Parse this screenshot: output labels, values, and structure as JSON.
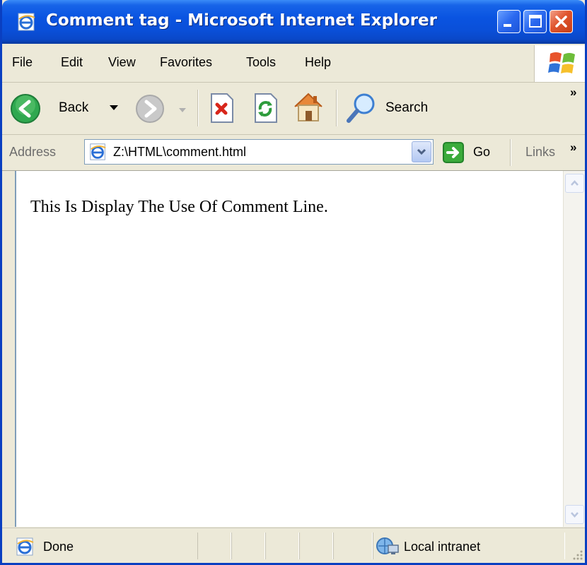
{
  "window": {
    "title": "Comment tag - Microsoft Internet Explorer"
  },
  "menu": {
    "items": [
      "File",
      "Edit",
      "View",
      "Favorites",
      "Tools",
      "Help"
    ]
  },
  "toolbar": {
    "back_label": "Back",
    "search_label": "Search",
    "more_chevron": "»"
  },
  "address": {
    "label": "Address",
    "value": "Z:\\HTML\\comment.html",
    "go_label": "Go",
    "links_label": "Links",
    "links_chevron": "»"
  },
  "page": {
    "text": "This Is Display The Use Of Comment Line."
  },
  "status": {
    "text": "Done",
    "zone": "Local intranet"
  },
  "colors": {
    "titlebar": "#0a54e1",
    "chrome": "#ece9d8",
    "close_button": "#e0552e",
    "back_green": "#2fa84f"
  },
  "icons": [
    "ie-page-icon",
    "minimize-icon",
    "maximize-icon",
    "close-icon",
    "windows-logo-icon",
    "back-arrow-icon",
    "dropdown-arrow-icon",
    "forward-arrow-icon",
    "stop-icon",
    "refresh-icon",
    "home-icon",
    "search-icon",
    "go-arrow-icon",
    "resize-grip-icon",
    "local-intranet-icon"
  ]
}
